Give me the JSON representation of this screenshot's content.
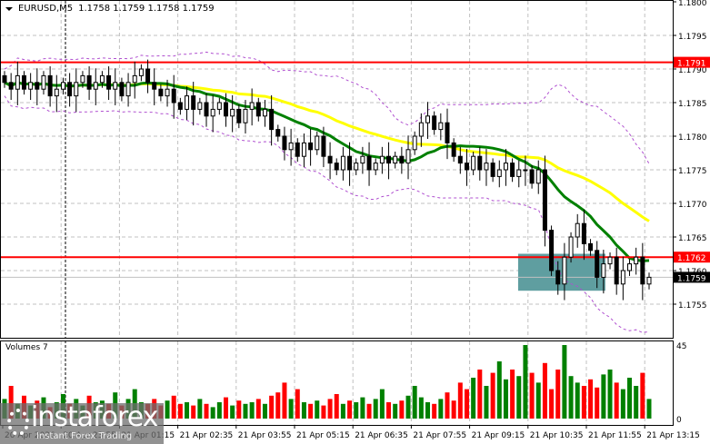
{
  "header": {
    "symbol": "EURUSD,M5",
    "ohlc": "1.1758 1.1759 1.1758 1.1759"
  },
  "volume_title": "Volumes 7",
  "logo": {
    "name": "instaforex",
    "tagline": "Instant Forex Trading"
  },
  "colors": {
    "bull_volume": "#008000",
    "bear_volume": "#ff0000",
    "ma_fast": "#008000",
    "ma_slow": "#ffff00",
    "bands": "#b050d0",
    "level": "#ff0000",
    "zone": "#5f9ea0"
  },
  "chart_data": {
    "type": "candlestick",
    "title": "EURUSD,M5",
    "ylim": [
      1.175,
      1.1802
    ],
    "y_ticks": [
      "1.1800",
      "1.1795",
      "1.1790",
      "1.1785",
      "1.1780",
      "1.1775",
      "1.1770",
      "1.1765",
      "1.1760",
      "1.1755"
    ],
    "x_ticks": [
      "20 Apr 2026",
      "20 Apr 23:55",
      "21 Apr 01:15",
      "21 Apr 02:35",
      "21 Apr 03:55",
      "21 Apr 05:15",
      "21 Apr 06:35",
      "21 Apr 07:55",
      "21 Apr 09:15",
      "21 Apr 10:35",
      "21 Apr 11:55",
      "21 Apr 13:15"
    ],
    "levels": [
      {
        "price": 1.1791,
        "label": "1.1791"
      },
      {
        "price": 1.1762,
        "label": "1.1762"
      }
    ],
    "current_price": {
      "price": 1.1759,
      "label": "1.1759"
    },
    "zone": {
      "from_price": 1.1757,
      "to_price": 1.17625,
      "from_index": 80,
      "to_index": 92
    },
    "closes": [
      1.1788,
      1.1787,
      1.1789,
      1.1787,
      1.1788,
      1.1787,
      1.1789,
      1.1786,
      1.1787,
      1.1788,
      1.1786,
      1.1788,
      1.1789,
      1.1787,
      1.1788,
      1.1789,
      1.1787,
      1.1788,
      1.1786,
      1.1788,
      1.1789,
      1.179,
      1.1788,
      1.1787,
      1.1786,
      1.1787,
      1.1785,
      1.1784,
      1.1786,
      1.1784,
      1.1785,
      1.1783,
      1.1784,
      1.1785,
      1.1783,
      1.1784,
      1.1782,
      1.1784,
      1.1785,
      1.1783,
      1.1784,
      1.1781,
      1.178,
      1.1778,
      1.1779,
      1.1777,
      1.1779,
      1.1778,
      1.178,
      1.1777,
      1.1776,
      1.1775,
      1.1777,
      1.1775,
      1.1776,
      1.1777,
      1.1775,
      1.1776,
      1.1777,
      1.1776,
      1.1777,
      1.1776,
      1.1778,
      1.178,
      1.1782,
      1.1783,
      1.1781,
      1.1782,
      1.1779,
      1.1777,
      1.1776,
      1.1775,
      1.1777,
      1.1775,
      1.1776,
      1.1774,
      1.1775,
      1.1776,
      1.1774,
      1.1775,
      1.1775,
      1.1773,
      1.1775,
      1.1766,
      1.176,
      1.1758,
      1.1762,
      1.1765,
      1.1767,
      1.1764,
      1.1763,
      1.1759,
      1.1761,
      1.1762,
      1.1758,
      1.176,
      1.1761,
      1.1762,
      1.1758,
      1.1759
    ],
    "volume": {
      "max_label": "45",
      "min_label": "0",
      "ylim": [
        0,
        45
      ],
      "values": [
        12,
        20,
        9,
        14,
        8,
        11,
        13,
        7,
        10,
        15,
        9,
        12,
        8,
        14,
        10,
        11,
        9,
        16,
        8,
        12,
        18,
        10,
        9,
        12,
        8,
        11,
        14,
        9,
        10,
        8,
        12,
        9,
        7,
        10,
        13,
        8,
        11,
        9,
        10,
        12,
        9,
        14,
        16,
        22,
        12,
        18,
        10,
        9,
        11,
        8,
        12,
        15,
        9,
        11,
        10,
        13,
        9,
        12,
        18,
        10,
        9,
        11,
        14,
        20,
        13,
        10,
        9,
        12,
        16,
        11,
        22,
        18,
        25,
        30,
        20,
        28,
        35,
        24,
        30,
        26,
        45,
        28,
        22,
        34,
        18,
        30,
        45,
        26,
        22,
        20,
        24,
        19,
        27,
        30,
        22,
        18,
        25,
        20,
        28,
        12
      ]
    }
  }
}
